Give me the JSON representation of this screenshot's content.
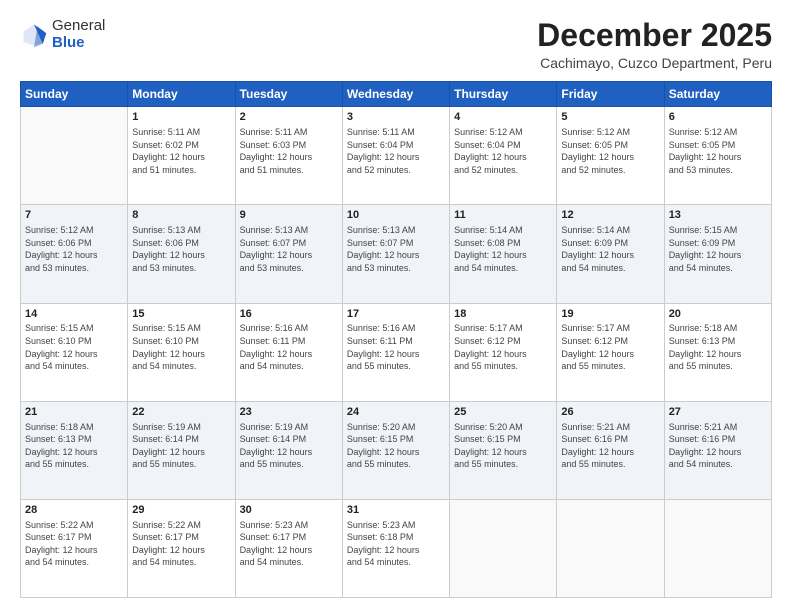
{
  "logo": {
    "general": "General",
    "blue": "Blue"
  },
  "header": {
    "title": "December 2025",
    "subtitle": "Cachimayo, Cuzco Department, Peru"
  },
  "columns": [
    "Sunday",
    "Monday",
    "Tuesday",
    "Wednesday",
    "Thursday",
    "Friday",
    "Saturday"
  ],
  "weeks": [
    [
      {
        "day": "",
        "detail": ""
      },
      {
        "day": "1",
        "detail": "Sunrise: 5:11 AM\nSunset: 6:02 PM\nDaylight: 12 hours\nand 51 minutes."
      },
      {
        "day": "2",
        "detail": "Sunrise: 5:11 AM\nSunset: 6:03 PM\nDaylight: 12 hours\nand 51 minutes."
      },
      {
        "day": "3",
        "detail": "Sunrise: 5:11 AM\nSunset: 6:04 PM\nDaylight: 12 hours\nand 52 minutes."
      },
      {
        "day": "4",
        "detail": "Sunrise: 5:12 AM\nSunset: 6:04 PM\nDaylight: 12 hours\nand 52 minutes."
      },
      {
        "day": "5",
        "detail": "Sunrise: 5:12 AM\nSunset: 6:05 PM\nDaylight: 12 hours\nand 52 minutes."
      },
      {
        "day": "6",
        "detail": "Sunrise: 5:12 AM\nSunset: 6:05 PM\nDaylight: 12 hours\nand 53 minutes."
      }
    ],
    [
      {
        "day": "7",
        "detail": "Sunrise: 5:12 AM\nSunset: 6:06 PM\nDaylight: 12 hours\nand 53 minutes."
      },
      {
        "day": "8",
        "detail": "Sunrise: 5:13 AM\nSunset: 6:06 PM\nDaylight: 12 hours\nand 53 minutes."
      },
      {
        "day": "9",
        "detail": "Sunrise: 5:13 AM\nSunset: 6:07 PM\nDaylight: 12 hours\nand 53 minutes."
      },
      {
        "day": "10",
        "detail": "Sunrise: 5:13 AM\nSunset: 6:07 PM\nDaylight: 12 hours\nand 53 minutes."
      },
      {
        "day": "11",
        "detail": "Sunrise: 5:14 AM\nSunset: 6:08 PM\nDaylight: 12 hours\nand 54 minutes."
      },
      {
        "day": "12",
        "detail": "Sunrise: 5:14 AM\nSunset: 6:09 PM\nDaylight: 12 hours\nand 54 minutes."
      },
      {
        "day": "13",
        "detail": "Sunrise: 5:15 AM\nSunset: 6:09 PM\nDaylight: 12 hours\nand 54 minutes."
      }
    ],
    [
      {
        "day": "14",
        "detail": "Sunrise: 5:15 AM\nSunset: 6:10 PM\nDaylight: 12 hours\nand 54 minutes."
      },
      {
        "day": "15",
        "detail": "Sunrise: 5:15 AM\nSunset: 6:10 PM\nDaylight: 12 hours\nand 54 minutes."
      },
      {
        "day": "16",
        "detail": "Sunrise: 5:16 AM\nSunset: 6:11 PM\nDaylight: 12 hours\nand 54 minutes."
      },
      {
        "day": "17",
        "detail": "Sunrise: 5:16 AM\nSunset: 6:11 PM\nDaylight: 12 hours\nand 55 minutes."
      },
      {
        "day": "18",
        "detail": "Sunrise: 5:17 AM\nSunset: 6:12 PM\nDaylight: 12 hours\nand 55 minutes."
      },
      {
        "day": "19",
        "detail": "Sunrise: 5:17 AM\nSunset: 6:12 PM\nDaylight: 12 hours\nand 55 minutes."
      },
      {
        "day": "20",
        "detail": "Sunrise: 5:18 AM\nSunset: 6:13 PM\nDaylight: 12 hours\nand 55 minutes."
      }
    ],
    [
      {
        "day": "21",
        "detail": "Sunrise: 5:18 AM\nSunset: 6:13 PM\nDaylight: 12 hours\nand 55 minutes."
      },
      {
        "day": "22",
        "detail": "Sunrise: 5:19 AM\nSunset: 6:14 PM\nDaylight: 12 hours\nand 55 minutes."
      },
      {
        "day": "23",
        "detail": "Sunrise: 5:19 AM\nSunset: 6:14 PM\nDaylight: 12 hours\nand 55 minutes."
      },
      {
        "day": "24",
        "detail": "Sunrise: 5:20 AM\nSunset: 6:15 PM\nDaylight: 12 hours\nand 55 minutes."
      },
      {
        "day": "25",
        "detail": "Sunrise: 5:20 AM\nSunset: 6:15 PM\nDaylight: 12 hours\nand 55 minutes."
      },
      {
        "day": "26",
        "detail": "Sunrise: 5:21 AM\nSunset: 6:16 PM\nDaylight: 12 hours\nand 55 minutes."
      },
      {
        "day": "27",
        "detail": "Sunrise: 5:21 AM\nSunset: 6:16 PM\nDaylight: 12 hours\nand 54 minutes."
      }
    ],
    [
      {
        "day": "28",
        "detail": "Sunrise: 5:22 AM\nSunset: 6:17 PM\nDaylight: 12 hours\nand 54 minutes."
      },
      {
        "day": "29",
        "detail": "Sunrise: 5:22 AM\nSunset: 6:17 PM\nDaylight: 12 hours\nand 54 minutes."
      },
      {
        "day": "30",
        "detail": "Sunrise: 5:23 AM\nSunset: 6:17 PM\nDaylight: 12 hours\nand 54 minutes."
      },
      {
        "day": "31",
        "detail": "Sunrise: 5:23 AM\nSunset: 6:18 PM\nDaylight: 12 hours\nand 54 minutes."
      },
      {
        "day": "",
        "detail": ""
      },
      {
        "day": "",
        "detail": ""
      },
      {
        "day": "",
        "detail": ""
      }
    ]
  ]
}
